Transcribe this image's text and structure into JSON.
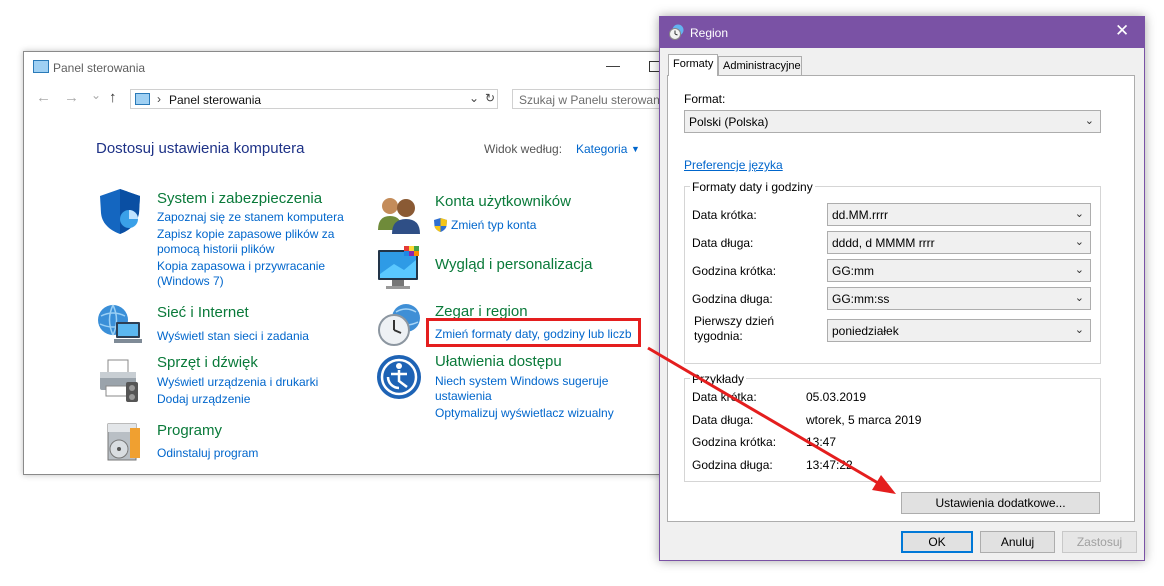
{
  "control_panel": {
    "window_title": "Panel sterowania",
    "min_glyph": "—",
    "nav_back": "←",
    "nav_forward": "→",
    "nav_recent": "⌄",
    "nav_up": "↑",
    "address_sep": "›",
    "address": "Panel sterowania",
    "address_dropdown": "⌄",
    "refresh": "↻",
    "search_placeholder": "Szukaj w Panelu sterowania",
    "heading": "Dostosuj ustawienia komputera",
    "view_label": "Widok według:",
    "view_value": "Kategoria",
    "view_arrow": "▼",
    "categories": [
      {
        "title": "System i zabezpieczenia",
        "icon": "shield-icon",
        "links": [
          "Zapoznaj się ze stanem komputera",
          "Zapisz kopie zapasowe plików za",
          "pomocą historii plików",
          "Kopia zapasowa i przywracanie",
          "(Windows 7)"
        ]
      },
      {
        "title": "Sieć i Internet",
        "icon": "network-globe-icon",
        "links": [
          "Wyświetl stan sieci i zadania"
        ]
      },
      {
        "title": "Sprzęt i dźwięk",
        "icon": "printer-icon",
        "links": [
          "Wyświetl urządzenia i drukarki",
          "Dodaj urządzenie"
        ]
      },
      {
        "title": "Programy",
        "icon": "programs-icon",
        "links": [
          "Odinstaluj program"
        ]
      },
      {
        "title": "Konta użytkowników",
        "icon": "users-icon",
        "links": [
          "Zmień typ konta"
        ]
      },
      {
        "title": "Wygląd i personalizacja",
        "icon": "display-icon",
        "links": []
      },
      {
        "title": "Zegar i region",
        "icon": "clock-globe-icon",
        "links": [
          "Zmień formaty daty, godziny lub liczb"
        ]
      },
      {
        "title": "Ułatwienia dostępu",
        "icon": "accessibility-icon",
        "links": [
          "Niech system Windows sugeruje",
          "ustawienia",
          "Optymalizuj wyświetlacz wizualny"
        ]
      }
    ]
  },
  "region_dialog": {
    "title": "Region",
    "close_glyph": "✕",
    "tabs": [
      "Formaty",
      "Administracyjne"
    ],
    "format_label": "Format:",
    "format_value": "Polski (Polska)",
    "combo_arrow": "⌄",
    "language_prefs_link": "Preferencje języka",
    "date_time_group_title": "Formaty daty i godziny",
    "fields": [
      {
        "label": "Data krótka:",
        "value": "dd.MM.rrrr"
      },
      {
        "label": "Data długa:",
        "value": "dddd, d MMMM rrrr"
      },
      {
        "label": "Godzina krótka:",
        "value": "GG:mm"
      },
      {
        "label": "Godzina długa:",
        "value": "GG:mm:ss"
      },
      {
        "label_line1": "Pierwszy dzień",
        "label_line2": "tygodnia:",
        "value": "poniedziałek"
      }
    ],
    "examples_group_title": "Przykłady",
    "examples": [
      {
        "label": "Data krótka:",
        "value": "05.03.2019"
      },
      {
        "label": "Data długa:",
        "value": "wtorek, 5 marca 2019"
      },
      {
        "label": "Godzina krótka:",
        "value": "13:47"
      },
      {
        "label": "Godzina długa:",
        "value": "13:47:22"
      }
    ],
    "additional_settings_button": "Ustawienia dodatkowe...",
    "ok_button": "OK",
    "cancel_button": "Anuluj",
    "apply_button": "Zastosuj"
  },
  "annotation": {
    "highlight_color": "#e41e1e"
  }
}
